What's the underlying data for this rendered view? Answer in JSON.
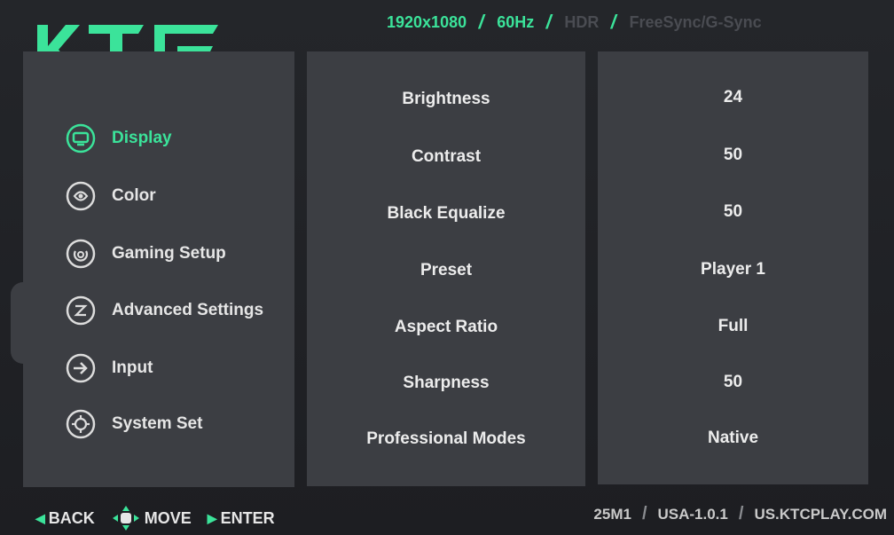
{
  "brand": {
    "logo_text": "KTC",
    "accent_color": "#3be39a"
  },
  "status_bar": {
    "resolution": "1920x1080",
    "refresh_rate": "60Hz",
    "hdr": "HDR",
    "sync": "FreeSync/G-Sync"
  },
  "menu": {
    "items": [
      {
        "label": "Display",
        "icon": "monitor-icon",
        "active": true
      },
      {
        "label": "Color",
        "icon": "color-icon",
        "active": false
      },
      {
        "label": "Gaming Setup",
        "icon": "gaming-icon",
        "active": false
      },
      {
        "label": "Advanced Settings",
        "icon": "advanced-icon",
        "active": false
      },
      {
        "label": "Input",
        "icon": "input-icon",
        "active": false
      },
      {
        "label": "System Set",
        "icon": "gear-icon",
        "active": false
      }
    ]
  },
  "settings": [
    {
      "label": "Brightness",
      "value": "24"
    },
    {
      "label": "Contrast",
      "value": "50"
    },
    {
      "label": "Black Equalize",
      "value": "50"
    },
    {
      "label": "Preset",
      "value": "Player 1"
    },
    {
      "label": "Aspect Ratio",
      "value": "Full"
    },
    {
      "label": "Sharpness",
      "value": "50"
    },
    {
      "label": "Professional Modes",
      "value": "Native"
    }
  ],
  "footer": {
    "back": "BACK",
    "move": "MOVE",
    "enter": "ENTER",
    "model": "25M1",
    "firmware": "USA-1.0.1",
    "website": "US.KTCPLAY.COM"
  }
}
